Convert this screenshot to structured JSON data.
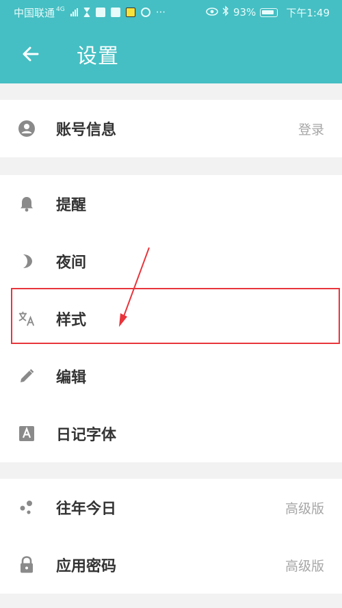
{
  "status_bar": {
    "carrier": "中国联通",
    "network": "4G",
    "battery": "93%",
    "time": "下午1:49"
  },
  "app_bar": {
    "title": "设置"
  },
  "sections": [
    {
      "rows": [
        {
          "label": "账号信息",
          "icon": "account-circle-icon",
          "right": "登录"
        }
      ]
    },
    {
      "rows": [
        {
          "label": "提醒",
          "icon": "bell-icon",
          "right": ""
        },
        {
          "label": "夜间",
          "icon": "moon-icon",
          "right": ""
        },
        {
          "label": "样式",
          "icon": "translate-icon",
          "right": ""
        },
        {
          "label": "编辑",
          "icon": "pencil-icon",
          "right": ""
        },
        {
          "label": "日记字体",
          "icon": "font-a-icon",
          "right": ""
        }
      ]
    },
    {
      "rows": [
        {
          "label": "往年今日",
          "icon": "dots-icon",
          "right": "高级版"
        },
        {
          "label": "应用密码",
          "icon": "lock-icon",
          "right": "高级版"
        }
      ]
    }
  ],
  "colors": {
    "accent": "#45bfc3",
    "annotation": "#e8343b"
  }
}
